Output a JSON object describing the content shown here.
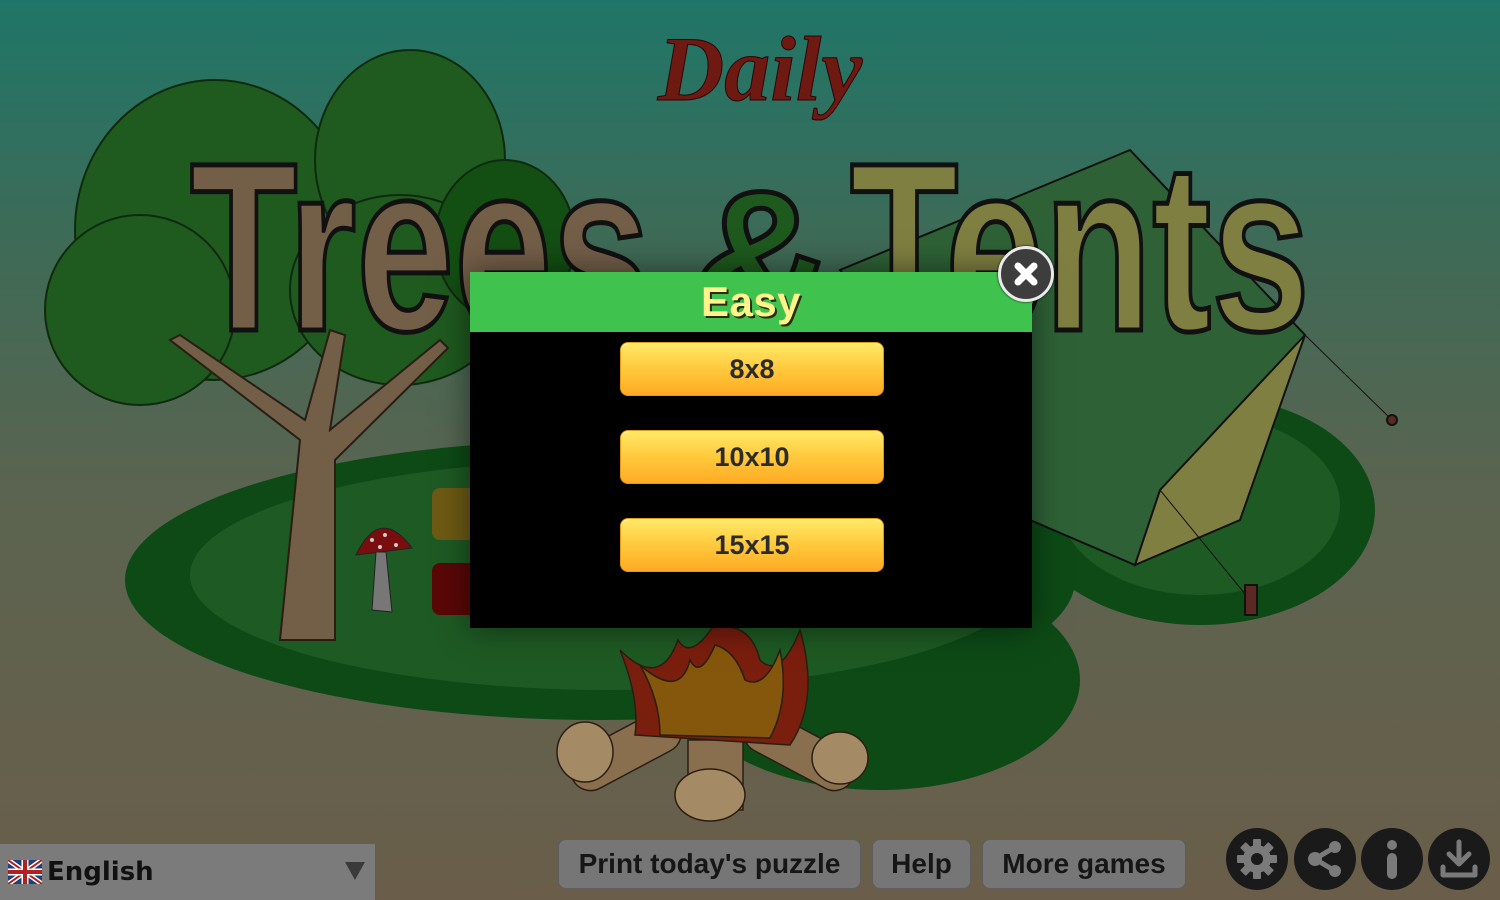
{
  "title": {
    "daily": "Daily",
    "trees": "Trees",
    "ampersand": "&",
    "tents": "Tents"
  },
  "modal": {
    "title": "Easy",
    "options": [
      "8x8",
      "10x10",
      "15x15"
    ],
    "close_icon": "close-icon"
  },
  "footer": {
    "language": {
      "label": "English",
      "flag": "uk-flag-icon",
      "arrow": "dropdown-arrow-icon"
    },
    "buttons": {
      "print": "Print today's puzzle",
      "help": "Help",
      "more_games": "More games"
    },
    "icons": [
      "gear-icon",
      "share-icon",
      "info-icon",
      "download-icon"
    ]
  },
  "colors": {
    "header_green": "#3fc24e",
    "title_yellow": "#fff58a",
    "button_orange": "#ffc93c",
    "daily_red": "#6e1a12",
    "trees_brown": "#735e48",
    "tents_olive": "#7f7f42"
  }
}
